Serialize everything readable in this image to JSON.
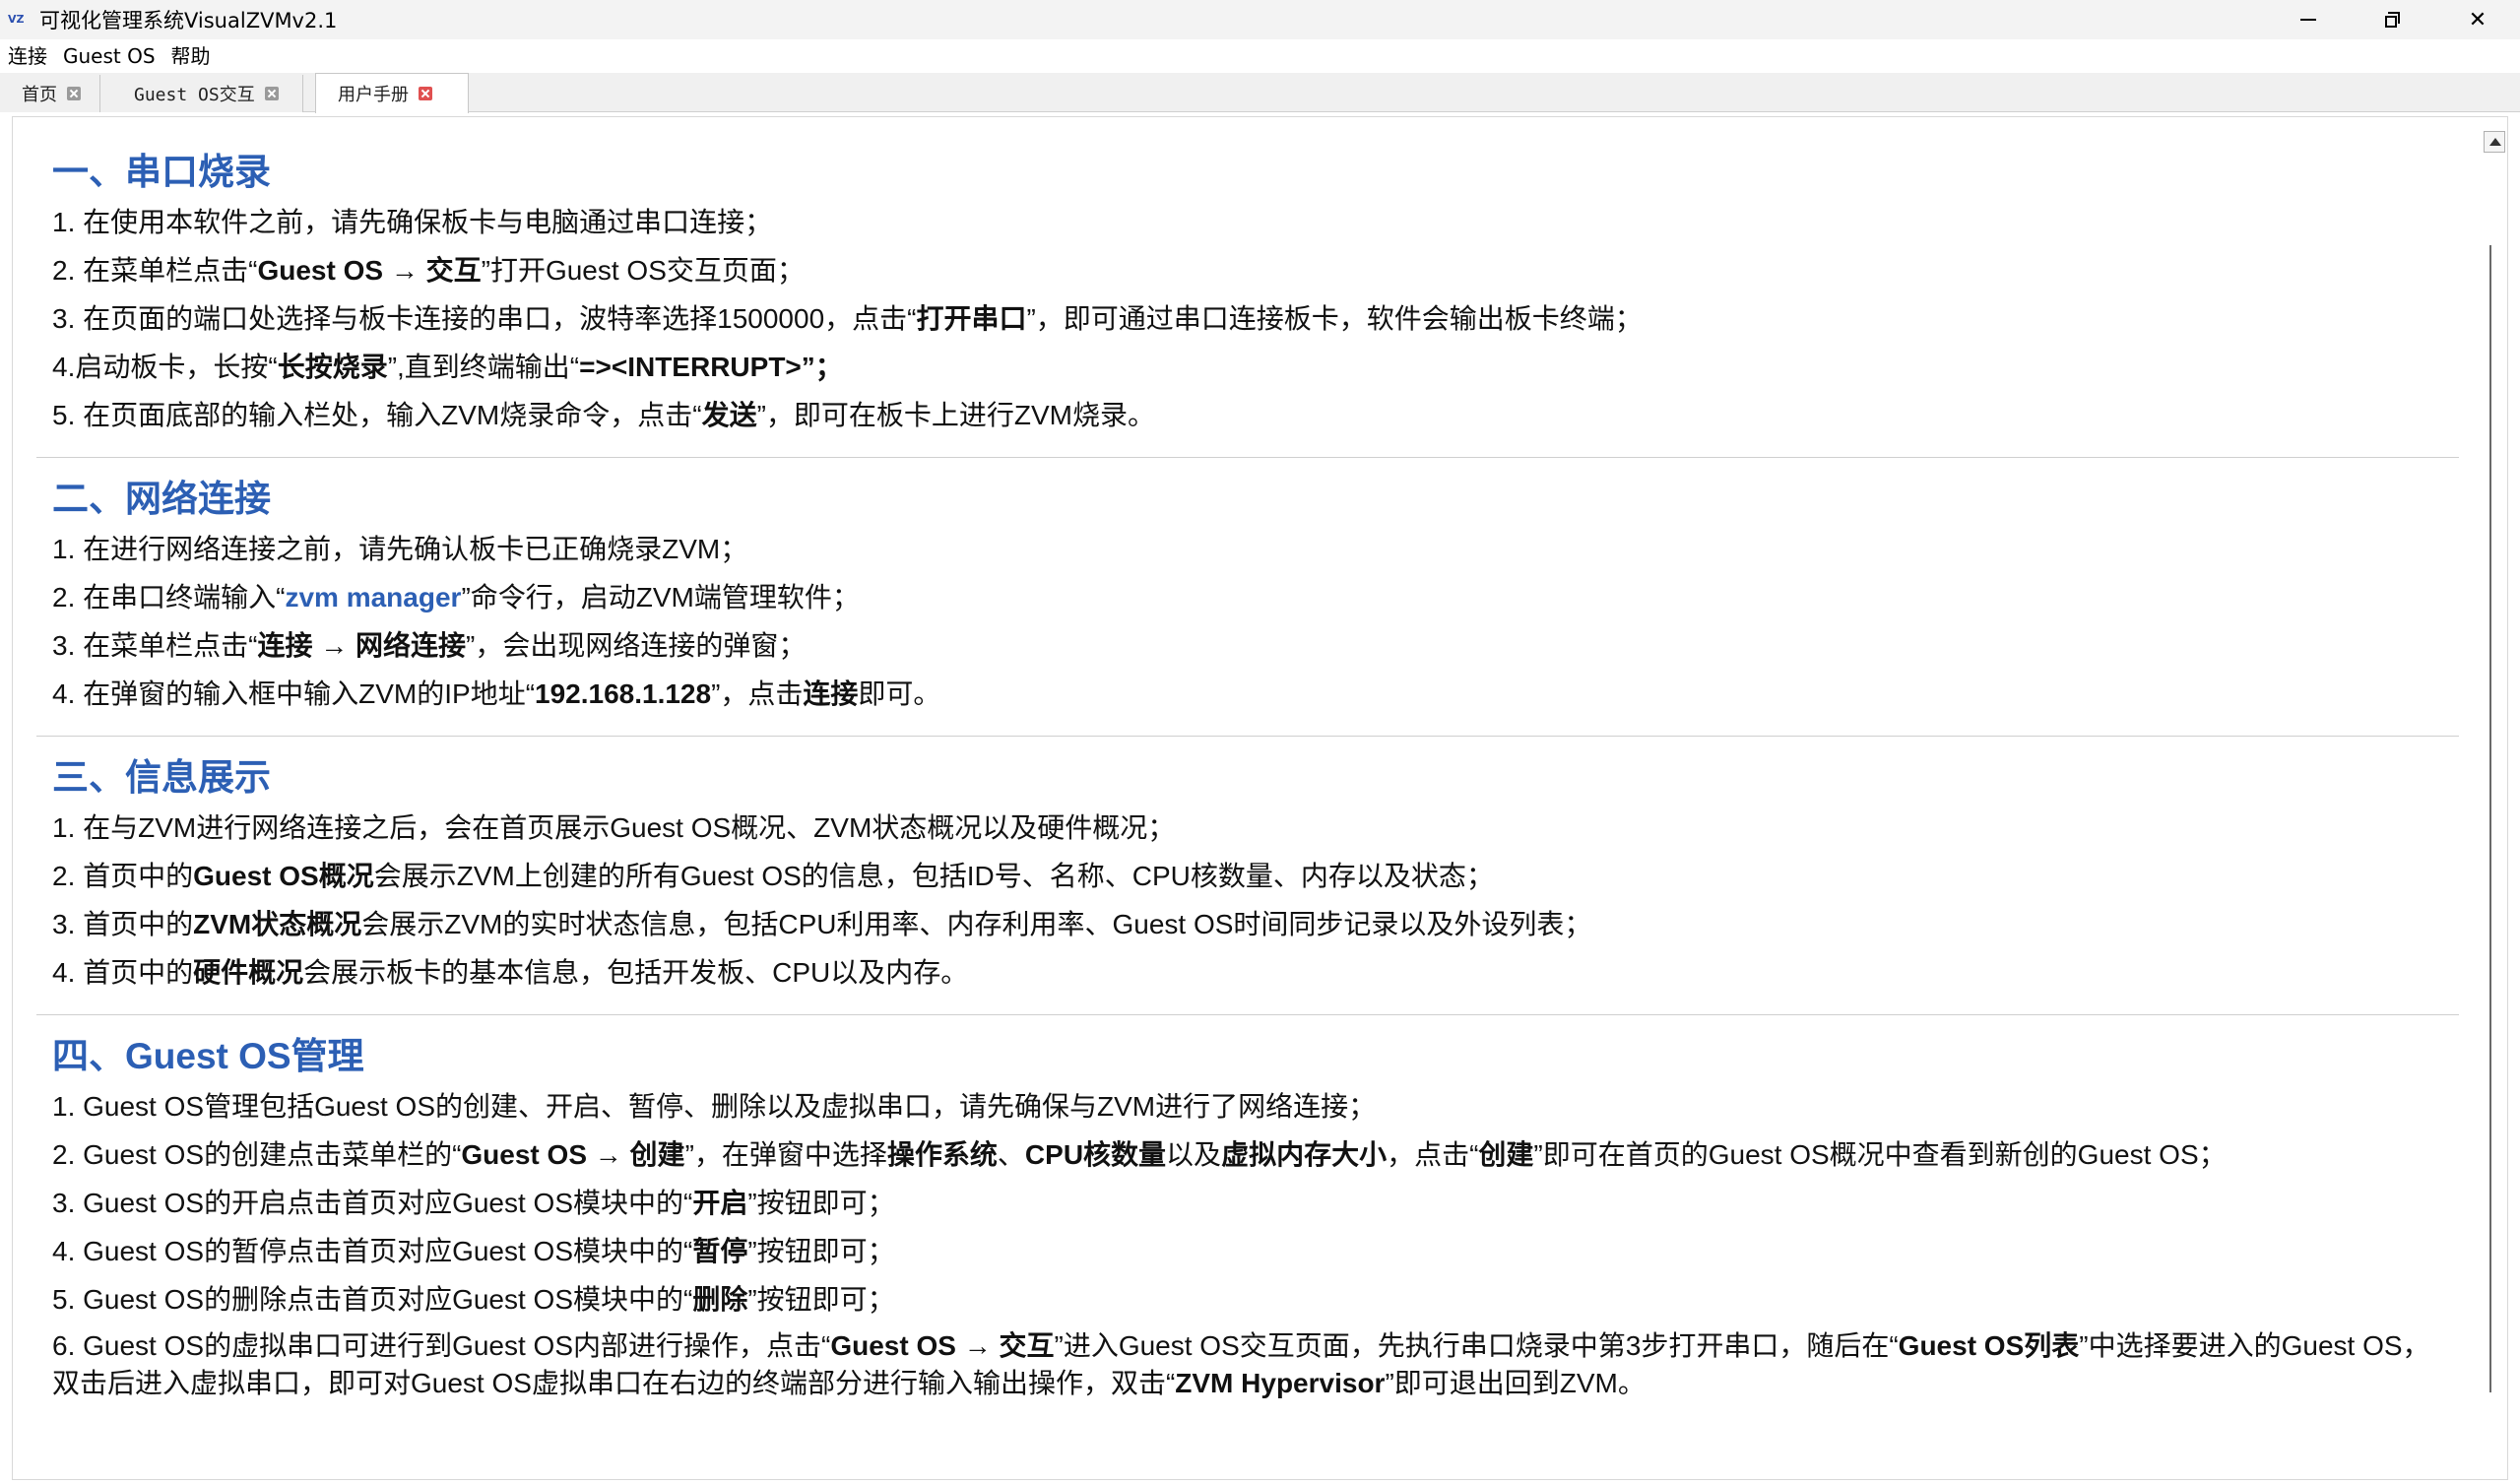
{
  "window": {
    "title": "可视化管理系统VisualZVMv2.1",
    "icon_name": "app-logo-icon",
    "controls": [
      "minimize-icon",
      "restore-icon",
      "close-icon"
    ]
  },
  "menu": [
    "连接",
    "Guest OS",
    "帮助"
  ],
  "tabs": [
    {
      "label": "首页",
      "active": false
    },
    {
      "label": "Guest OS交互",
      "active": false
    },
    {
      "label": "用户手册",
      "active": true
    }
  ],
  "sections": [
    {
      "title": "一、串口烧录",
      "lines": [
        [
          {
            "t": "1. 在使用本软件之前，请先确保板卡与电脑通过串口连接；"
          }
        ],
        [
          {
            "t": "2. 在菜单栏点击“"
          },
          {
            "t": "Guest OS → 交互",
            "b": true
          },
          {
            "t": "”打开Guest OS交互页面；"
          }
        ],
        [
          {
            "t": "3. 在页面的端口处选择与板卡连接的串口，波特率选择1500000，点击“"
          },
          {
            "t": "打开串口",
            "b": true
          },
          {
            "t": "”，即可通过串口连接板卡，软件会输出板卡终端；"
          }
        ],
        [
          {
            "t": "4.启动板卡，长按“"
          },
          {
            "t": "长按烧录",
            "b": true
          },
          {
            "t": "”,直到终端输出“"
          },
          {
            "t": "=><INTERRUPT>”；",
            "b": true
          }
        ],
        [
          {
            "t": "5. 在页面底部的输入栏处，输入ZVM烧录命令，点击“"
          },
          {
            "t": "发送",
            "b": true
          },
          {
            "t": "”，即可在板卡上进行ZVM烧录。"
          }
        ]
      ]
    },
    {
      "title": "二、网络连接",
      "lines": [
        [
          {
            "t": "1. 在进行网络连接之前，请先确认板卡已正确烧录ZVM；"
          }
        ],
        [
          {
            "t": "2. 在串口终端输入“"
          },
          {
            "t": "zvm manager",
            "hl": true
          },
          {
            "t": "”命令行，启动ZVM端管理软件；"
          }
        ],
        [
          {
            "t": "3. 在菜单栏点击“"
          },
          {
            "t": "连接 → 网络连接",
            "b": true
          },
          {
            "t": "”，会出现网络连接的弹窗；"
          }
        ],
        [
          {
            "t": "4. 在弹窗的输入框中输入ZVM的IP地址“"
          },
          {
            "t": "192.168.1.128",
            "b": true
          },
          {
            "t": "”，点击"
          },
          {
            "t": "连接",
            "b": true
          },
          {
            "t": "即可。"
          }
        ]
      ]
    },
    {
      "title": "三、信息展示",
      "lines": [
        [
          {
            "t": "1. 在与ZVM进行网络连接之后，会在首页展示Guest OS概况、ZVM状态概况以及硬件概况；"
          }
        ],
        [
          {
            "t": "2. 首页中的"
          },
          {
            "t": "Guest OS概况",
            "b": true
          },
          {
            "t": "会展示ZVM上创建的所有Guest OS的信息，包括ID号、名称、CPU核数量、内存以及状态；"
          }
        ],
        [
          {
            "t": "3. 首页中的"
          },
          {
            "t": "ZVM状态概况",
            "b": true
          },
          {
            "t": "会展示ZVM的实时状态信息，包括CPU利用率、内存利用率、Guest OS时间同步记录以及外设列表；"
          }
        ],
        [
          {
            "t": "4. 首页中的"
          },
          {
            "t": "硬件概况",
            "b": true
          },
          {
            "t": "会展示板卡的基本信息，包括开发板、CPU以及内存。"
          }
        ]
      ]
    },
    {
      "title": "四、Guest OS管理",
      "lines": [
        [
          {
            "t": "1. Guest OS管理包括Guest OS的创建、开启、暂停、删除以及虚拟串口，请先确保与ZVM进行了网络连接；"
          }
        ],
        [
          {
            "t": "2. Guest OS的创建点击菜单栏的“"
          },
          {
            "t": "Guest OS → 创建",
            "b": true
          },
          {
            "t": "”，在弹窗中选择"
          },
          {
            "t": "操作系统",
            "b": true
          },
          {
            "t": "、"
          },
          {
            "t": "CPU核数量",
            "b": true
          },
          {
            "t": "以及"
          },
          {
            "t": "虚拟内存大小",
            "b": true
          },
          {
            "t": "，点击“"
          },
          {
            "t": "创建",
            "b": true
          },
          {
            "t": "”即可在首页的Guest OS概况中查看到新创的Guest OS；"
          }
        ],
        [
          {
            "t": "3. Guest OS的开启点击首页对应Guest OS模块中的“"
          },
          {
            "t": "开启",
            "b": true
          },
          {
            "t": "”按钮即可；"
          }
        ],
        [
          {
            "t": "4. Guest OS的暂停点击首页对应Guest OS模块中的“"
          },
          {
            "t": "暂停",
            "b": true
          },
          {
            "t": "”按钮即可；"
          }
        ],
        [
          {
            "t": "5. Guest OS的删除点击首页对应Guest OS模块中的“"
          },
          {
            "t": "删除",
            "b": true
          },
          {
            "t": "”按钮即可；"
          }
        ],
        [
          {
            "t": "6. Guest OS的虚拟串口可进行到Guest OS内部进行操作，点击“"
          },
          {
            "t": "Guest OS → 交互",
            "b": true
          },
          {
            "t": "”进入Guest OS交互页面，先执行串口烧录中第3步打开串口，随后在“"
          },
          {
            "t": "Guest OS列表",
            "b": true
          },
          {
            "t": "”中选择要进入的Guest OS，双击后进入虚拟串口，即可对Guest OS虚拟串口在右边的终端部分进行输入输出操作，双击“"
          },
          {
            "t": "ZVM Hypervisor",
            "b": true
          },
          {
            "t": "”即可退出回到ZVM。"
          }
        ]
      ]
    }
  ]
}
